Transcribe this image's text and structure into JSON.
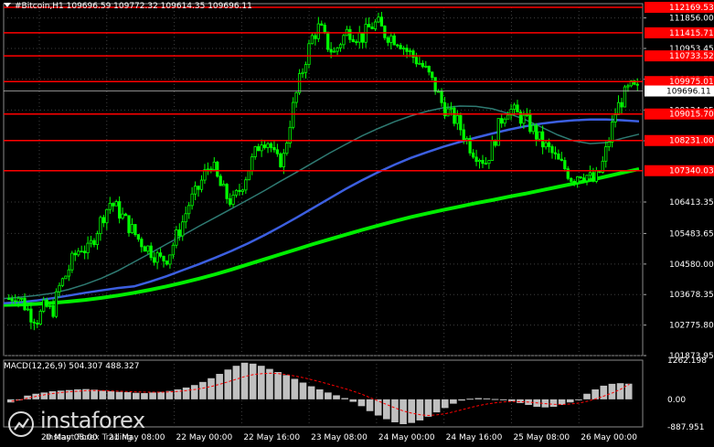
{
  "header": {
    "text": "#Bitcoin,H1  109696.59 109772.32 109614.35 109696.11"
  },
  "macd_label": "MACD(12,26,9) 504.307 488.327",
  "watermark": {
    "brand": "instaforex",
    "tagline": "Instant Forex Trading"
  },
  "colors": {
    "background": "#000000",
    "grid": "#404040",
    "candle": "#00ff00",
    "ma_fast": "#2e7a72",
    "ma_mid": "#3c5fe0",
    "ma_slow": "#00ee00",
    "level": "#ff0000",
    "macd_hist": "#c0c0c0",
    "macd_signal": "#ff0000"
  },
  "chart_data": [
    {
      "type": "candlestick",
      "symbol": "#Bitcoin",
      "timeframe": "H1",
      "ohlc_last": {
        "open": 109696.59,
        "high": 109772.32,
        "low": 109614.35,
        "close": 109696.11
      },
      "ylim": [
        101873.95,
        112169.53
      ],
      "y_ticks": [
        111856.0,
        110953.45,
        110043.75,
        109134.05,
        108224.35,
        107314.65,
        106413.35,
        105483.65,
        104580.0,
        103678.35,
        102775.8,
        101873.95
      ],
      "x_ticks": [
        "19 May 2025",
        "20 May 08:00",
        "21 May 08:00",
        "22 May 00:00",
        "22 May 16:00",
        "23 May 08:00",
        "24 May 00:00",
        "24 May 16:00",
        "25 May 08:00",
        "26 May 00:00"
      ],
      "visible_axis_labels": [
        "111856.00",
        "110953.45",
        "110043.75",
        "109134.05",
        "108224.35",
        "106413.35",
        "105483.65",
        "104580.00",
        "103678.35",
        "102775.80",
        "101873.95"
      ],
      "visible_date_labels": [
        "20 May 08:00",
        "21 May 08:00",
        "22 May 00:00",
        "22 May 16:00",
        "23 May 08:00",
        "24 May 00:00",
        "24 May 16:00",
        "25 May 08:00",
        "26 May 00:00"
      ],
      "horizontal_levels": [
        112169.53,
        111415.71,
        110733.52,
        109975.01,
        109015.7,
        108231.0,
        107340.03
      ],
      "current_price": 109696.11,
      "trend_points": [
        103560,
        103700,
        103420,
        103100,
        102950,
        103350,
        103150,
        103900,
        104300,
        104800,
        105100,
        104950,
        105500,
        106000,
        106400,
        106200,
        105900,
        105600,
        105300,
        105100,
        104900,
        104700,
        104800,
        105300,
        105800,
        106400,
        106700,
        107200,
        107600,
        107000,
        106600,
        106400,
        106800,
        107300,
        107800,
        108300,
        108200,
        107600,
        107700,
        108900,
        109800,
        110600,
        111300,
        111600,
        111100,
        110800,
        111200,
        111500,
        111350,
        111300,
        111600,
        111700,
        111400,
        111300,
        111200,
        110900,
        110700,
        110500,
        110200,
        109800,
        109300,
        109000,
        108800,
        108400,
        108000,
        107800,
        107600,
        108100,
        108800,
        109200,
        109050,
        108900,
        108700,
        108400,
        108100,
        107900,
        107600,
        107400,
        107100,
        107300,
        107200,
        107000,
        107400,
        108200,
        109100,
        109500,
        109800,
        109700
      ],
      "series": [
        {
          "name": "",
          "values": [
            103560,
            103600,
            103650,
            103720,
            103830,
            103980,
            104160,
            104380,
            104640,
            104900,
            105170,
            105430,
            105700,
            105960,
            106220,
            106480,
            106750,
            107030,
            107300,
            107580,
            107860,
            108120,
            108370,
            108590,
            108790,
            108960,
            109100,
            109200,
            109250,
            109240,
            109170,
            109030,
            108850,
            108630,
            108400,
            108220,
            108140,
            108170,
            108300,
            108420
          ]
        },
        {
          "name": "",
          "values": [
            103420,
            103450,
            103500,
            103570,
            103650,
            103730,
            103800,
            103870,
            103920,
            104060,
            104220,
            104400,
            104580,
            104770,
            104970,
            105190,
            105430,
            105690,
            105960,
            106240,
            106520,
            106800,
            107060,
            107300,
            107520,
            107720,
            107890,
            108050,
            108190,
            108320,
            108440,
            108550,
            108650,
            108730,
            108790,
            108830,
            108850,
            108850,
            108830,
            108800
          ]
        },
        {
          "name": "",
          "values": [
            103370,
            103380,
            103400,
            103430,
            103470,
            103520,
            103580,
            103650,
            103730,
            103820,
            103920,
            104030,
            104150,
            104280,
            104420,
            104570,
            104720,
            104870,
            105020,
            105170,
            105310,
            105450,
            105590,
            105720,
            105850,
            105970,
            106080,
            106180,
            106280,
            106380,
            106470,
            106570,
            106660,
            106760,
            106860,
            106960,
            107060,
            107170,
            107280,
            107390
          ]
        }
      ]
    },
    {
      "type": "bar",
      "name": "MACD(12,26,9)",
      "macd": 504.307,
      "signal": 488.327,
      "ylim": [
        -887.951,
        1262.198
      ],
      "y_ticks": [
        1262.198,
        0.0,
        -887.951
      ],
      "y_tick_labels": [
        "1262.198",
        "0.00",
        "-887.951"
      ],
      "values": [
        -100,
        0,
        120,
        180,
        220,
        260,
        280,
        300,
        320,
        330,
        310,
        280,
        260,
        240,
        230,
        210,
        200,
        220,
        240,
        270,
        320,
        380,
        460,
        560,
        680,
        820,
        960,
        1080,
        1180,
        1150,
        1080,
        980,
        880,
        780,
        660,
        540,
        420,
        320,
        220,
        130,
        40,
        -80,
        -220,
        -380,
        -520,
        -640,
        -740,
        -800,
        -760,
        -680,
        -560,
        -420,
        -280,
        -140,
        -40,
        20,
        40,
        30,
        10,
        -20,
        -60,
        -120,
        -180,
        -240,
        -260,
        -240,
        -180,
        -100,
        0,
        180,
        320,
        440,
        500,
        520,
        504
      ],
      "signal_values": [
        -60,
        -20,
        40,
        100,
        150,
        190,
        220,
        245,
        265,
        280,
        285,
        280,
        270,
        260,
        250,
        240,
        232,
        230,
        232,
        240,
        258,
        285,
        320,
        365,
        420,
        490,
        570,
        656,
        740,
        800,
        830,
        840,
        825,
        795,
        750,
        695,
        630,
        560,
        490,
        415,
        340,
        255,
        160,
        50,
        -60,
        -175,
        -285,
        -380,
        -450,
        -500,
        -520,
        -500,
        -460,
        -400,
        -330,
        -260,
        -200,
        -150,
        -110,
        -80,
        -70,
        -75,
        -90,
        -115,
        -140,
        -160,
        -165,
        -150,
        -120,
        -60,
        20,
        110,
        210,
        330,
        488
      ]
    }
  ]
}
